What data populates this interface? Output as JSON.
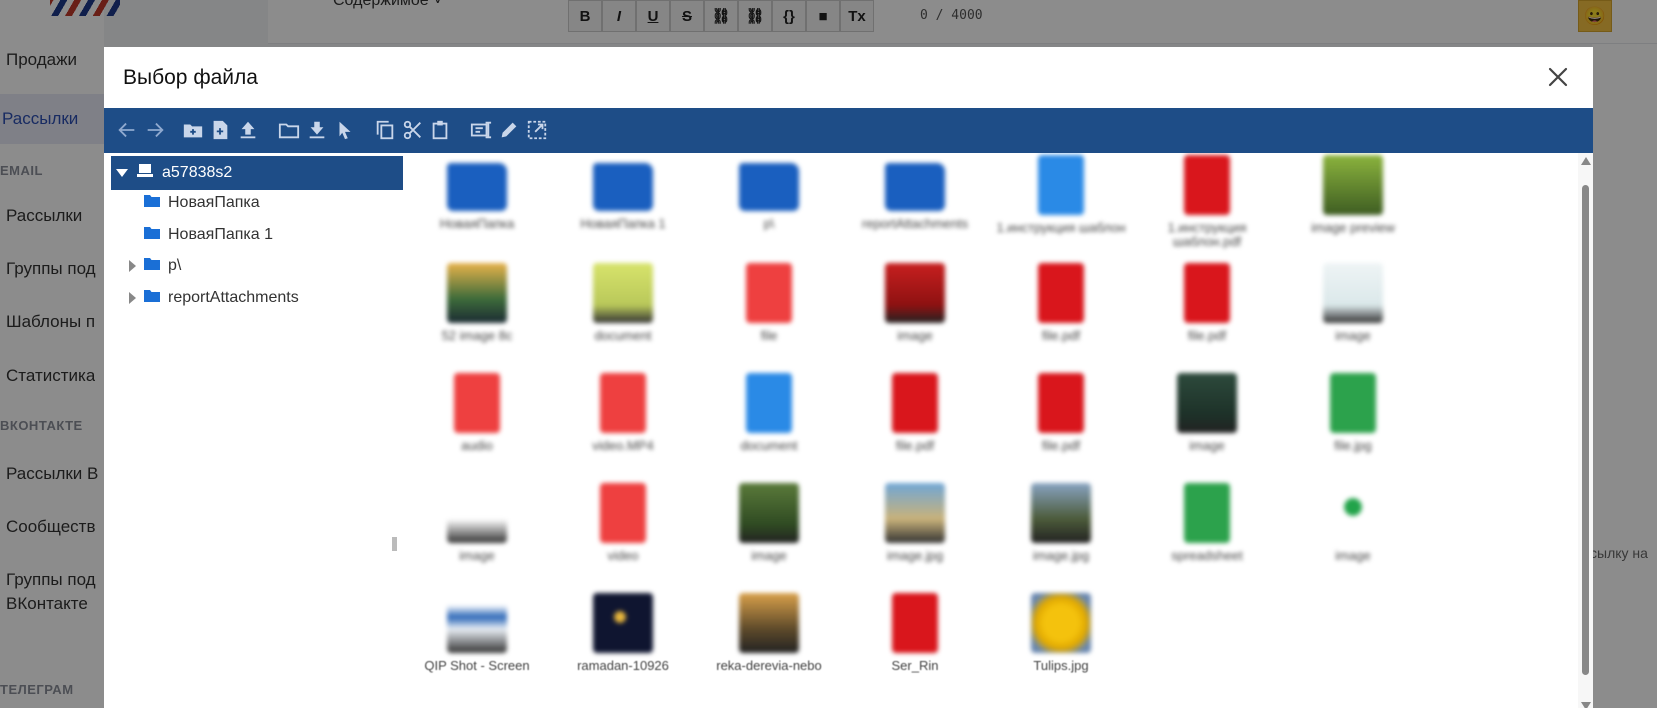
{
  "background": {
    "sidebar": {
      "items": [
        {
          "label": "Продажи"
        },
        {
          "label": "Рассылки"
        },
        {
          "label": "Рассылки"
        },
        {
          "label": "Группы под"
        },
        {
          "label": "Шаблоны п"
        },
        {
          "label": "Статистика"
        },
        {
          "label": "Рассылки В"
        },
        {
          "label": "Сообществ"
        },
        {
          "label": "Группы под"
        },
        {
          "label": "ВКонтакте"
        }
      ],
      "sections": [
        "EMAIL",
        "ВКОНТАКТЕ",
        "ТЕЛЕГРАМ"
      ]
    },
    "content_label": "Содержимое ˅",
    "char_counter": "0 / 4000",
    "emoji": "😀",
    "right_text": "сылку на"
  },
  "modal": {
    "title": "Выбор файла",
    "close_icon": "close-icon"
  },
  "toolbar": {
    "buttons": [
      "back-icon",
      "forward-icon",
      "new-folder-icon",
      "new-file-icon",
      "upload-icon",
      "open-folder-icon",
      "download-icon",
      "select-icon",
      "copy-icon",
      "cut-icon",
      "paste-icon",
      "rename-icon",
      "edit-icon",
      "resize-icon"
    ]
  },
  "tree": {
    "root": {
      "label": "a57838s2"
    },
    "nodes": [
      {
        "label": "НоваяПапка",
        "expandable": false
      },
      {
        "label": "НоваяПапка 1",
        "expandable": false
      },
      {
        "label": "p\\",
        "expandable": true
      },
      {
        "label": "reportAttachments",
        "expandable": true
      }
    ]
  },
  "files": {
    "visible_names": {
      "r4c0": "QIP Shot - Screen",
      "r4c1": "ramadan-10926",
      "r4c2": "reka-derevia-nebo",
      "r4c3": "Ser_Rin",
      "r4c4": "Tulips.jpg"
    }
  },
  "colors": {
    "accent": "#1e4d87",
    "folder": "#1a5fbf",
    "pdf": "#d9161c",
    "doc": "#2a8ae6",
    "sheet": "#2ca24c"
  }
}
